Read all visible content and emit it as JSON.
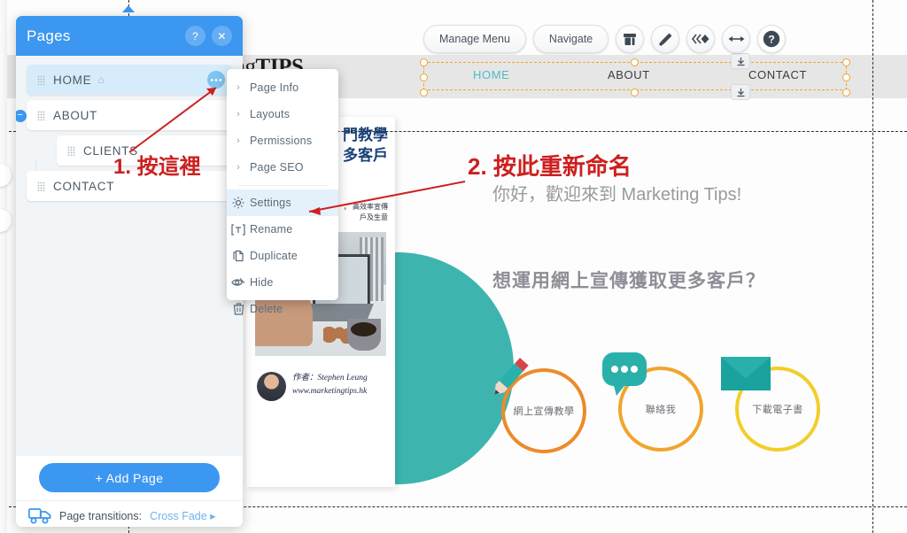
{
  "toolbar": {
    "manage_menu_label": "Manage Menu",
    "navigate_label": "Navigate",
    "buttons": [
      {
        "name": "archive-icon",
        "glyph": "▤"
      },
      {
        "name": "brush-icon",
        "glyph": "✐"
      },
      {
        "name": "animation-icon",
        "glyph": "«◆"
      },
      {
        "name": "resize-icon",
        "glyph": "↔"
      },
      {
        "name": "help-icon",
        "glyph": "?"
      }
    ]
  },
  "site": {
    "logo_prefix": "Marketing",
    "logo_suffix": "TIPS",
    "nav": [
      {
        "label": "HOME",
        "active": true
      },
      {
        "label": "ABOUT",
        "active": false
      },
      {
        "label": "CONTACT",
        "active": false
      }
    ],
    "hero_greeting": "你好，歡迎來到 Marketing Tips!",
    "hero_question": "想運用網上宣傳獲取更多客戶？",
    "book": {
      "title_line1": "門教學",
      "title_line2": "多客戶",
      "sub_line1": "， 高效率宣傳",
      "sub_line2": "戶及生意",
      "author": "作者：Stephen Leung",
      "website": "www.marketingtips.hk"
    },
    "circles": [
      {
        "label": "網上宣傳教學",
        "icon": "pencil-icon",
        "color": "#ec8b2a"
      },
      {
        "label": "聯絡我",
        "icon": "chat-bubble-icon",
        "color": "#f0a52e"
      },
      {
        "label": "下載電子書",
        "icon": "envelope-icon",
        "color": "#f3ce2a"
      }
    ]
  },
  "panel": {
    "title": "Pages",
    "help_glyph": "?",
    "close_glyph": "✕",
    "tree": [
      {
        "label": "HOME",
        "selected": true,
        "indent": false,
        "home_glyph": "⌂",
        "has_dots": true,
        "collapse": null
      },
      {
        "label": "ABOUT",
        "selected": false,
        "indent": false,
        "home_glyph": "",
        "has_dots": false,
        "collapse": "−"
      },
      {
        "label": "CLIENTS",
        "selected": false,
        "indent": true,
        "home_glyph": "",
        "has_dots": false,
        "collapse": null
      },
      {
        "label": "CONTACT",
        "selected": false,
        "indent": false,
        "home_glyph": "",
        "has_dots": false,
        "collapse": null
      }
    ],
    "add_page_label": "+  Add Page",
    "transitions_label": "Page transitions:",
    "transitions_value": "Cross Fade ▸"
  },
  "context_menu": {
    "submenu_items": [
      {
        "label": "Page Info",
        "chevron": "›"
      },
      {
        "label": "Layouts",
        "chevron": "›"
      },
      {
        "label": "Permissions",
        "chevron": "›"
      },
      {
        "label": "Page SEO",
        "chevron": "›"
      }
    ],
    "action_items": [
      {
        "label": "Settings",
        "icon": "gear-icon",
        "highlighted": true
      },
      {
        "label": "Rename",
        "icon": "text-rename-icon",
        "highlighted": false
      },
      {
        "label": "Duplicate",
        "icon": "duplicate-icon",
        "highlighted": false
      },
      {
        "label": "Hide",
        "icon": "eye-hide-icon",
        "highlighted": false
      },
      {
        "label": "Delete",
        "icon": "trash-icon",
        "highlighted": false
      }
    ]
  },
  "annotations": {
    "step1": "1. 按這裡",
    "step2": "2. 按此重新命名",
    "color": "#cd1f1f"
  },
  "colors": {
    "panel_header": "#3c97f0",
    "accent_blue": "#3c97f0",
    "teal": "#3db5ae",
    "selection_orange": "#f0a52e",
    "nav_active": "#4fb8c4"
  }
}
